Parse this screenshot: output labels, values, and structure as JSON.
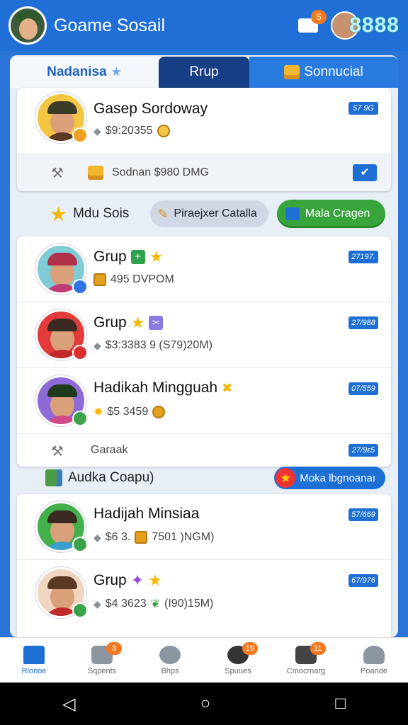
{
  "app": {
    "title": "Goame Sosail",
    "mail_badge": "5",
    "profile_code": "8888"
  },
  "tabs": [
    {
      "label": "Nadanisa"
    },
    {
      "label": "Rrup"
    },
    {
      "label": "Sonnucial"
    }
  ],
  "top_card": {
    "name": "Gasep Sordoway",
    "amount": "$9:20355",
    "tag": "57 9G",
    "info": "Sodnan $980 DMG"
  },
  "section1": {
    "label": "Mdu Sois",
    "pill_grey": "Piraejxer Catalla",
    "pill_green": "Mala Cragen"
  },
  "group_card": {
    "rows": [
      {
        "name": "Grup",
        "amount": "495 DVPOM",
        "tag": "27197."
      },
      {
        "name": "Grup",
        "amount": "$3:3383 9  (S79)20M)",
        "tag": "27/988"
      },
      {
        "name": "Hadikah Mingguah",
        "amount": "$5 3459",
        "tag": "07/559"
      }
    ],
    "footer_label": "Garaak",
    "footer_tag": "27/9ɛ5"
  },
  "section2": {
    "label": "Audka Coapu)",
    "pill": "Moka lbgnoanaı"
  },
  "bottom_card": {
    "rows": [
      {
        "name": "Hadijah Minsiaa",
        "amount": "$6 3.",
        "amount2": "7501 )NGM)",
        "tag": "57/669"
      },
      {
        "name": "Grup",
        "amount": "$4 3623",
        "amount2": "(I90)15M)",
        "tag": "67/976"
      }
    ]
  },
  "bottom_nav": [
    {
      "label": "Rlonoe",
      "badge": ""
    },
    {
      "label": "Sqpents",
      "badge": "3"
    },
    {
      "label": "Bhps",
      "badge": ""
    },
    {
      "label": "Spuues",
      "badge": "19"
    },
    {
      "label": "Cmocrnarg",
      "badge": "11"
    },
    {
      "label": "Poande",
      "badge": ""
    }
  ],
  "colors": {
    "primary": "#1f6fd6",
    "green": "#37a53b",
    "orange": "#f47a20",
    "star": "#f5b800"
  }
}
